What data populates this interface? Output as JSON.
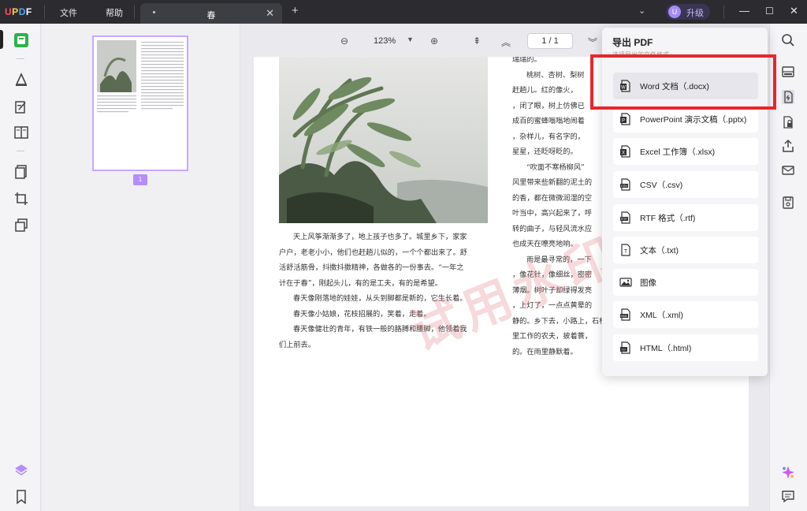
{
  "titlebar": {
    "logo": "UPDF",
    "menu_file": "文件",
    "menu_help": "帮助",
    "tab_title": "春",
    "upgrade_avatar": "U",
    "upgrade_label": "升级"
  },
  "toolbar": {
    "zoom": "123%",
    "page_indicator": "1 / 1"
  },
  "thumbnail": {
    "page_number": "1"
  },
  "document": {
    "left_paragraphs": [
      "天上风筝渐渐多了，地上孩子也多了。城里乡下，家家",
      "户户，老老小小，他们也赶趟儿似的，一个个都出来了。舒",
      "活舒活筋骨，抖擞抖擞精神，各做各的一份事去。“一年之",
      "计在于春”，刚起头儿，有的是工夫，有的是希望。",
      "春天像刚落地的娃娃，从头到脚都是新的，它生长着。",
      "春天像小姑娘，花枝招展的，笑着，走着。",
      "春天像健壮的青年，有铁一般的胳膊和腰脚，他领着我",
      "们上前去。"
    ],
    "right_lines": [
      "瑞瑞的。",
      "桃树、杏树、梨树",
      "赶趟儿。红的像火，",
      "，闭了眼，树上仿佛已",
      "成百的蜜蜂嗡嗡地闹着",
      "，杂样儿，有名字的，",
      "星星，还眨呀眨的。",
      "“吹面不寒杨柳风”",
      "风里带来些新翻的泥土的",
      "的香，都在微微润湿的空",
      "叶当中，高兴起来了，呼",
      "转的曲子，与轻风流水应",
      "也成天在嘹亮地响。",
      "雨是最寻常的，一下",
      "，像花针，像细丝，密密",
      "薄烟。树叶子却绿得发亮",
      "，上灯了，一点点黄晕的",
      "静的。乡下去，小路上，石桥边",
      "里工作的农夫，披着蓑，",
      "的。在雨里静默着。"
    ],
    "watermark": "试用水印"
  },
  "export_popup": {
    "title": "导出 PDF",
    "subtitle": "选择导出的文件格式",
    "options": [
      {
        "label": "Word 文档（.docx)",
        "icon": "word-icon",
        "selected": true
      },
      {
        "label": "PowerPoint 演示文稿（.pptx)",
        "icon": "powerpoint-icon",
        "selected": false
      },
      {
        "label": "Excel 工作簿（.xlsx)",
        "icon": "excel-icon",
        "selected": false
      },
      {
        "label": "CSV（.csv)",
        "icon": "csv-icon",
        "selected": false
      },
      {
        "label": "RTF 格式（.rtf)",
        "icon": "rtf-icon",
        "selected": false
      },
      {
        "label": "文本（.txt)",
        "icon": "text-file-icon",
        "selected": false
      },
      {
        "label": "图像",
        "icon": "image-icon",
        "selected": false
      },
      {
        "label": "XML（.xml)",
        "icon": "xml-icon",
        "selected": false
      },
      {
        "label": "HTML（.html)",
        "icon": "html-icon",
        "selected": false
      }
    ]
  },
  "colors": {
    "accent": "#b48dfb",
    "highlight_border": "#e8262b",
    "titlebar": "#2b2b30"
  }
}
